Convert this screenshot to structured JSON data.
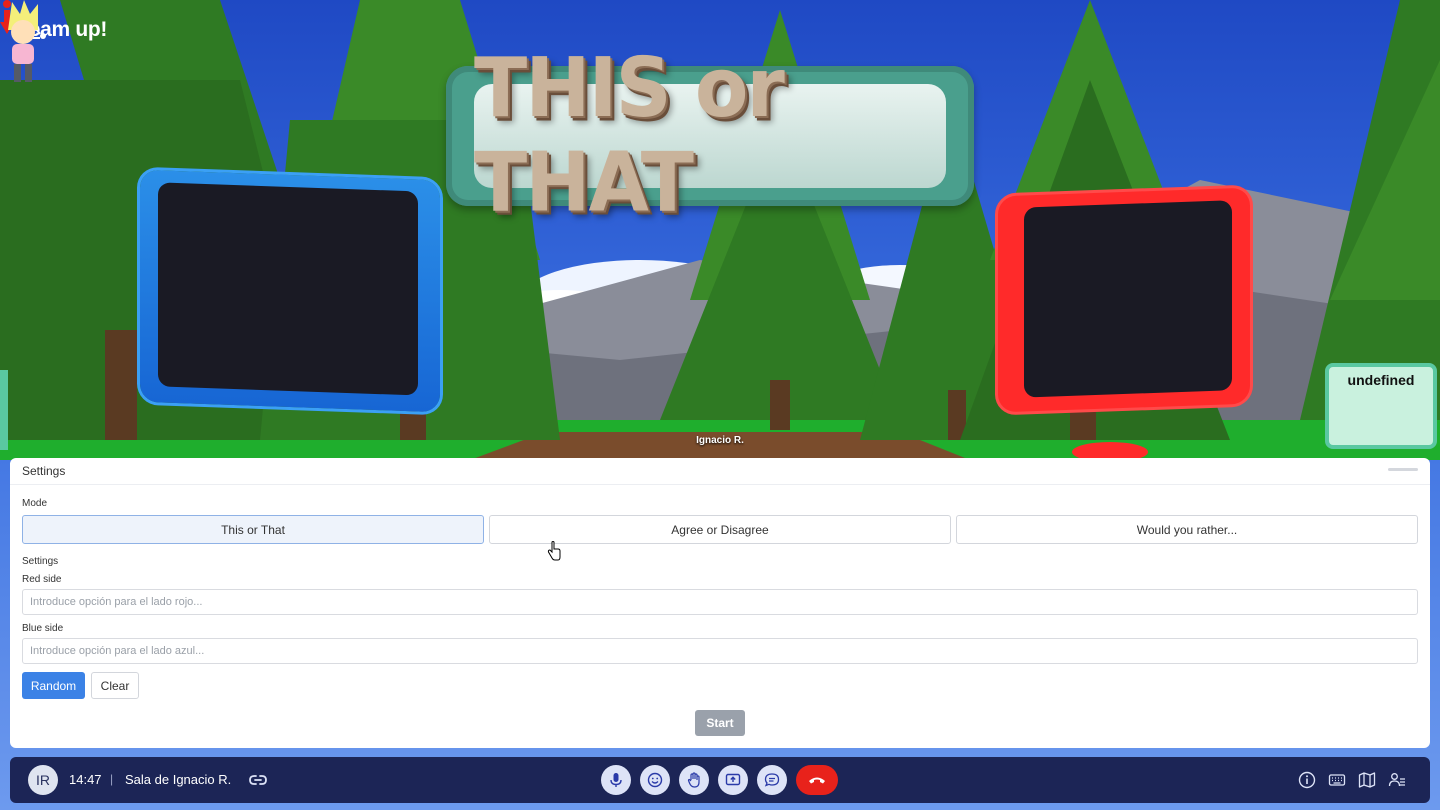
{
  "app": {
    "brand": "team up!"
  },
  "scene": {
    "title_sign": "THIS or THAT",
    "undefined_sign": "undefined",
    "avatar_name": "Ignacio R."
  },
  "settings": {
    "title": "Settings",
    "mode_label": "Mode",
    "modes": [
      "This or That",
      "Agree or Disagree",
      "Would you rather..."
    ],
    "active_mode": "This or That",
    "settings_label": "Settings",
    "red_side_label": "Red side",
    "red_side_placeholder": "Introduce opción para el lado rojo...",
    "blue_side_label": "Blue side",
    "blue_side_placeholder": "Introduce opción para el lado azul...",
    "random_label": "Random",
    "clear_label": "Clear",
    "start_label": "Start"
  },
  "bottombar": {
    "user_initials": "IR",
    "time": "14:47",
    "separator": "|",
    "room_name": "Sala de Ignacio R.",
    "controls": [
      "microphone-icon",
      "emoji-icon",
      "raise-hand-icon",
      "share-screen-icon",
      "chat-icon",
      "end-call-icon"
    ],
    "right_icons": [
      "info-icon",
      "keyboard-icon",
      "map-icon",
      "participants-icon"
    ]
  },
  "colors": {
    "accent": "#3b82e6",
    "bar": "#1c2556",
    "end_call": "#e8221b",
    "blue_board": "#1766d4",
    "red_board": "#ff2a2a"
  }
}
